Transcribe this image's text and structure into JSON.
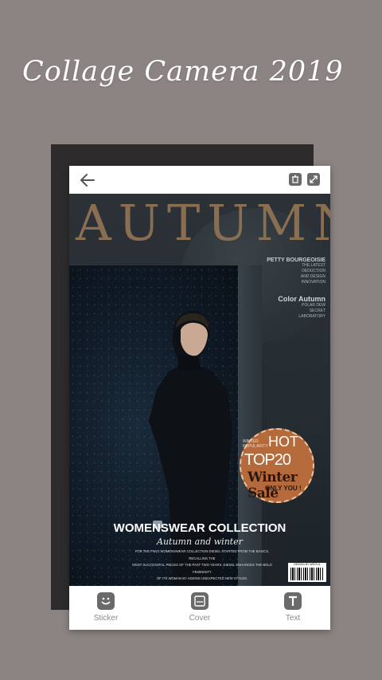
{
  "promo": {
    "title": "Collage Camera 2019"
  },
  "colors": {
    "background": "#8b8483",
    "autumn_title": "#8a6e52",
    "badge": "#b56a3b",
    "icon": "#6a6a6a"
  },
  "toolbar": {
    "back_icon": "back-arrow-icon",
    "delete_icon": "trash-icon",
    "expand_icon": "expand-icon"
  },
  "cover": {
    "headline": "AUTUMN",
    "side_title": "PETTY BOURGEOISIE",
    "side_lines": [
      "THE LATEST",
      "DEDUCTION",
      "AND DESIGN",
      "INNOVATION"
    ],
    "side_title2": "Color Autumn",
    "side_lines2": [
      "POLAR DEW",
      "SECRET",
      "LABORATORY"
    ],
    "badge": {
      "small1": "WINTER",
      "small2": "POPULARITY",
      "hot": "HOT",
      "top": "TOP20",
      "sale": "Winter Sale",
      "only": "ONLY YOU !"
    },
    "collection_title": "WOMENSWEAR COLLECTION",
    "collection_subtitle": "Autumn and winter",
    "collection_body": [
      "FOR THE FW21 WOMENSWEAR COLLECTION DIESEL STARTED FROM THE BASICS, RECALLING THE",
      "MOST SUCCESSFUL PIECES OF THE PAST TWO YEARS. DIESEL ENHANCES THE BOLD FEMININITY",
      "OF ITS WOMAN BY ADDING UNEXPECTED NEW STYLES."
    ],
    "barcode_text": "DESIGN BY WEIYUL"
  },
  "tools": [
    {
      "label": "Sticker",
      "icon": "sticker-icon"
    },
    {
      "label": "Cover",
      "icon": "cover-icon"
    },
    {
      "label": "Text",
      "icon": "text-icon"
    }
  ]
}
